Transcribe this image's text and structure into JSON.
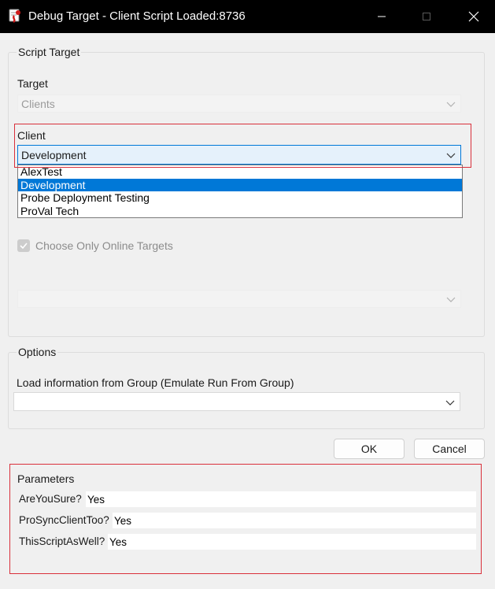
{
  "window": {
    "title": "Debug Target - Client Script Loaded:8736",
    "icon": "app-script-icon",
    "controls": [
      "minimize-icon",
      "maximize-icon",
      "close-icon"
    ]
  },
  "script_target": {
    "legend": "Script Target",
    "target_label": "Target",
    "target_value": "Clients",
    "client_label": "Client",
    "client_value": "Development",
    "client_options": [
      {
        "label": "AlexTest",
        "selected": false
      },
      {
        "label": "Development",
        "selected": true
      },
      {
        "label": "Probe Deployment Testing",
        "selected": false
      },
      {
        "label": "ProVal Tech",
        "selected": false
      }
    ],
    "online_only_label": "Choose Only Online Targets",
    "online_only_checked": true,
    "secondary_value": ""
  },
  "options": {
    "legend": "Options",
    "group_label": "Load information from Group (Emulate Run From Group)",
    "group_value": ""
  },
  "buttons": {
    "ok": "OK",
    "cancel": "Cancel"
  },
  "parameters": {
    "legend": "Parameters",
    "rows": [
      {
        "name": "AreYouSure?",
        "value": "Yes"
      },
      {
        "name": "ProSyncClientToo?",
        "value": "Yes"
      },
      {
        "name": "ThisScriptAsWell?",
        "value": "Yes"
      }
    ]
  },
  "colors": {
    "titlebar": "#000000",
    "dialog_bg": "#f0f0f0",
    "selection": "#0078d7",
    "highlight_box": "#d9303b"
  }
}
